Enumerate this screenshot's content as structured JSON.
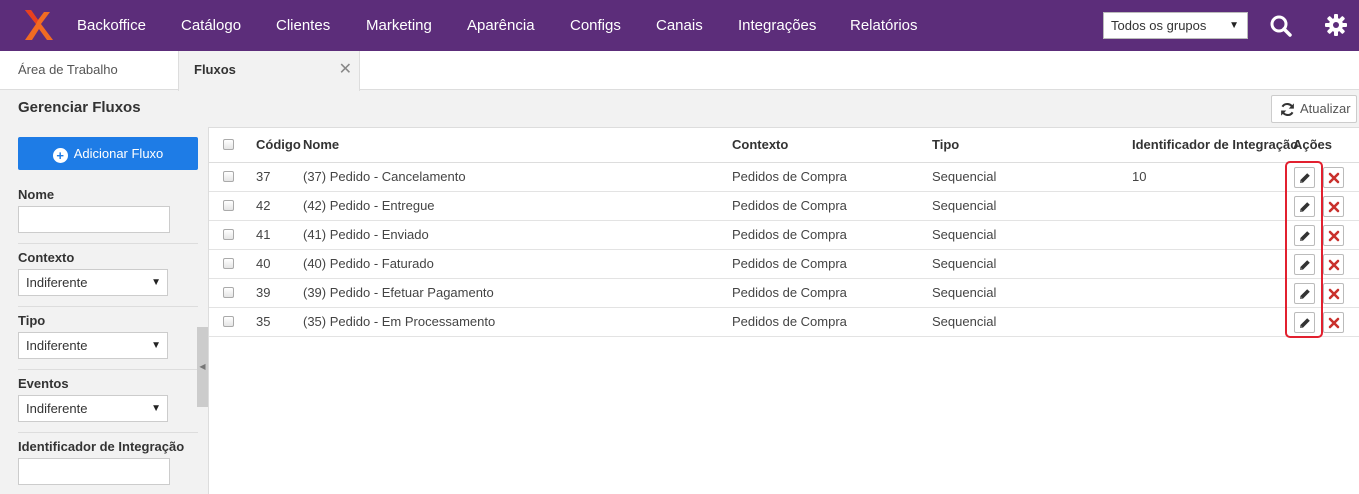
{
  "nav": {
    "items": [
      "Backoffice",
      "Catálogo",
      "Clientes",
      "Marketing",
      "Aparência",
      "Configs",
      "Canais",
      "Integrações",
      "Relatórios"
    ],
    "group_select": "Todos os grupos",
    "logo_icon": "x-logo-icon",
    "search_icon": "search-icon",
    "settings_icon": "gear-icon"
  },
  "tabs": [
    {
      "label": "Área de Trabalho",
      "active": false
    },
    {
      "label": "Fluxos",
      "active": true
    }
  ],
  "page": {
    "title": "Gerenciar Fluxos",
    "refresh_label": "Atualizar"
  },
  "sidebar": {
    "add_label": "Adicionar Fluxo",
    "filters": {
      "nome_label": "Nome",
      "nome_value": "",
      "contexto_label": "Contexto",
      "contexto_value": "Indiferente",
      "tipo_label": "Tipo",
      "tipo_value": "Indiferente",
      "eventos_label": "Eventos",
      "eventos_value": "Indiferente",
      "integracao_label": "Identificador de Integração",
      "integracao_value": ""
    }
  },
  "table": {
    "headers": {
      "codigo": "Código",
      "nome": "Nome",
      "contexto": "Contexto",
      "tipo": "Tipo",
      "integracao": "Identificador de Integração",
      "acoes": "Ações"
    },
    "rows": [
      {
        "codigo": "37",
        "nome": "(37) Pedido - Cancelamento",
        "contexto": "Pedidos de Compra",
        "tipo": "Sequencial",
        "integracao": "10"
      },
      {
        "codigo": "42",
        "nome": "(42) Pedido - Entregue",
        "contexto": "Pedidos de Compra",
        "tipo": "Sequencial",
        "integracao": ""
      },
      {
        "codigo": "41",
        "nome": "(41) Pedido - Enviado",
        "contexto": "Pedidos de Compra",
        "tipo": "Sequencial",
        "integracao": ""
      },
      {
        "codigo": "40",
        "nome": "(40) Pedido - Faturado",
        "contexto": "Pedidos de Compra",
        "tipo": "Sequencial",
        "integracao": ""
      },
      {
        "codigo": "39",
        "nome": "(39) Pedido - Efetuar Pagamento",
        "contexto": "Pedidos de Compra",
        "tipo": "Sequencial",
        "integracao": ""
      },
      {
        "codigo": "35",
        "nome": "(35) Pedido - Em Processamento",
        "contexto": "Pedidos de Compra",
        "tipo": "Sequencial",
        "integracao": ""
      }
    ]
  },
  "colors": {
    "nav_bg": "#5c2d7a",
    "primary_button": "#1e7ce6",
    "delete_icon": "#c9302c",
    "highlight": "#e2202f",
    "logo_orange": "#f26b22"
  }
}
